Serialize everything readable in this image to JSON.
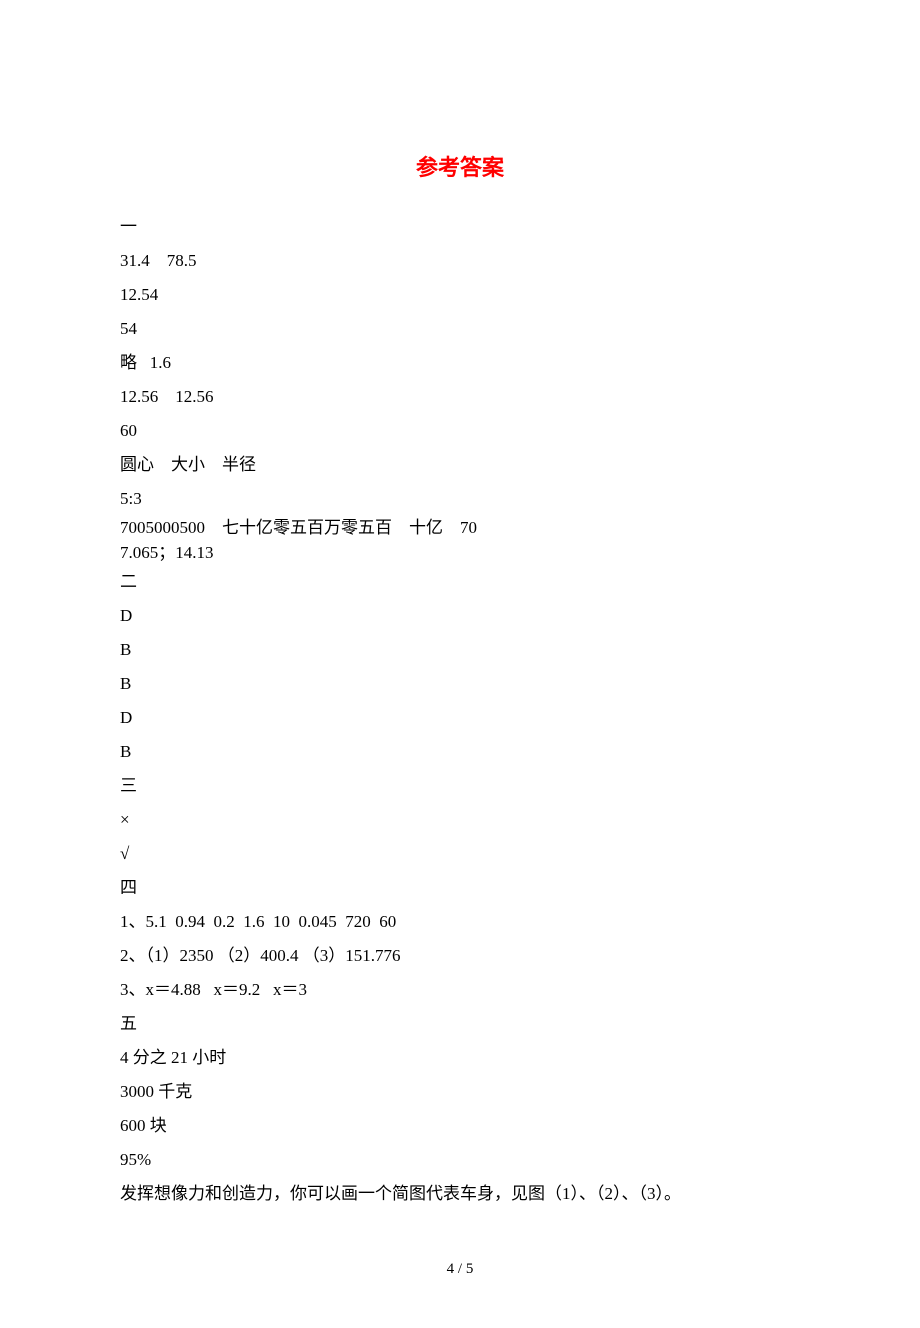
{
  "title": "参考答案",
  "lines": [
    "一",
    "31.4    78.5",
    "12.54",
    "54",
    "略   1.6",
    "12.56    12.56",
    "60",
    "圆心    大小    半径",
    "5:3",
    "7005000500    七十亿零五百万零五百    十亿    70",
    "7.065；14.13",
    "二",
    "D",
    "B",
    "B",
    "D",
    "B",
    "三",
    "×",
    "√",
    "四",
    "1、5.1  0.94  0.2  1.6  10  0.045  720  60",
    "2、（1）2350 （2）400.4 （3）151.776",
    "3、x＝4.88   x＝9.2   x＝3",
    "五",
    "4 分之 21 小时",
    "3000 千克",
    "600 块",
    "95%",
    "发挥想像力和创造力，你可以画一个简图代表车身，见图（1）、（2）、（3）。"
  ],
  "tightIndexes": [
    9,
    10
  ],
  "footer": "4 / 5"
}
